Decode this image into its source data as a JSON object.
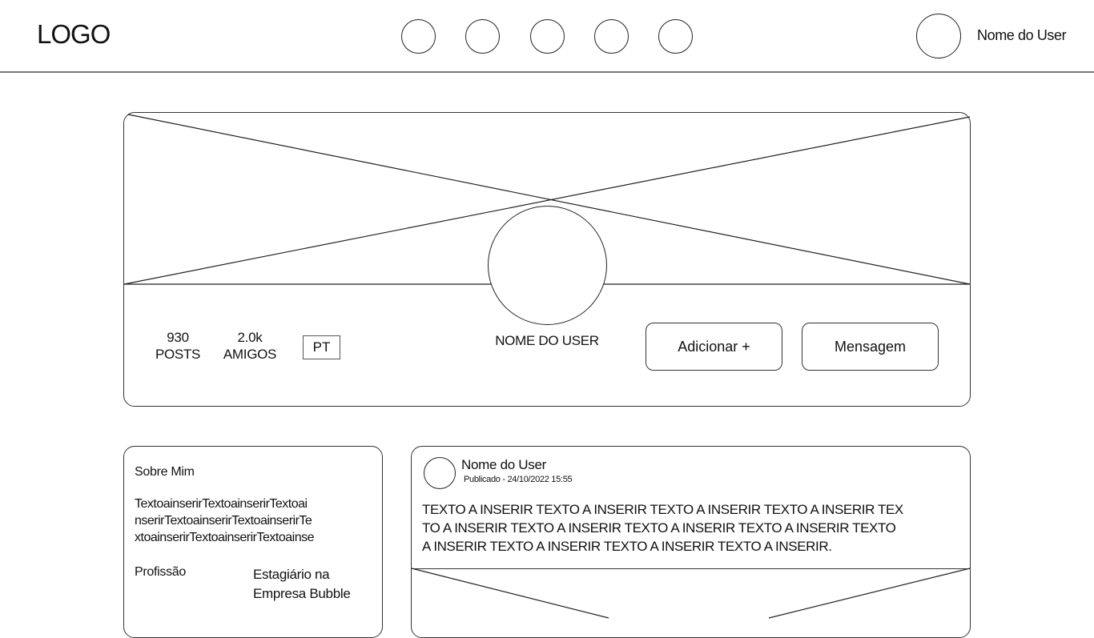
{
  "header": {
    "logo": "LOGO",
    "nav_icons": [
      "nav-icon-1",
      "nav-icon-2",
      "nav-icon-3",
      "nav-icon-4",
      "nav-icon-5"
    ],
    "user_name": "Nome do User"
  },
  "profile": {
    "name": "NOME DO USER",
    "stats": [
      {
        "value": "930",
        "label": "POSTS"
      },
      {
        "value": "2.0k",
        "label": "AMIGOS"
      }
    ],
    "language": "PT",
    "add_button": "Adicionar +",
    "message_button": "Mensagem"
  },
  "about": {
    "title": "Sobre Mim",
    "text_lines": [
      "TextoainserirTextoainserirTextoai",
      "nserirTextoainserirTextoainserirTe",
      "xtoainserirTextoainserirTextoainse"
    ],
    "profession_label": "Profissão",
    "profession_lines": [
      "Estagiário na",
      "Empresa Bubble"
    ]
  },
  "post": {
    "author": "Nome do User",
    "published": "Publicado - 24/10/2022 15:55",
    "text_lines": [
      "TEXTO A INSERIR TEXTO A INSERIR TEXTO A INSERIR TEXTO A INSERIR TEX",
      "TO A INSERIR TEXTO A INSERIR TEXTO A INSERIR TEXTO A INSERIR TEXTO",
      "A INSERIR TEXTO A INSERIR TEXTO A INSERIR TEXTO A INSERIR."
    ]
  }
}
